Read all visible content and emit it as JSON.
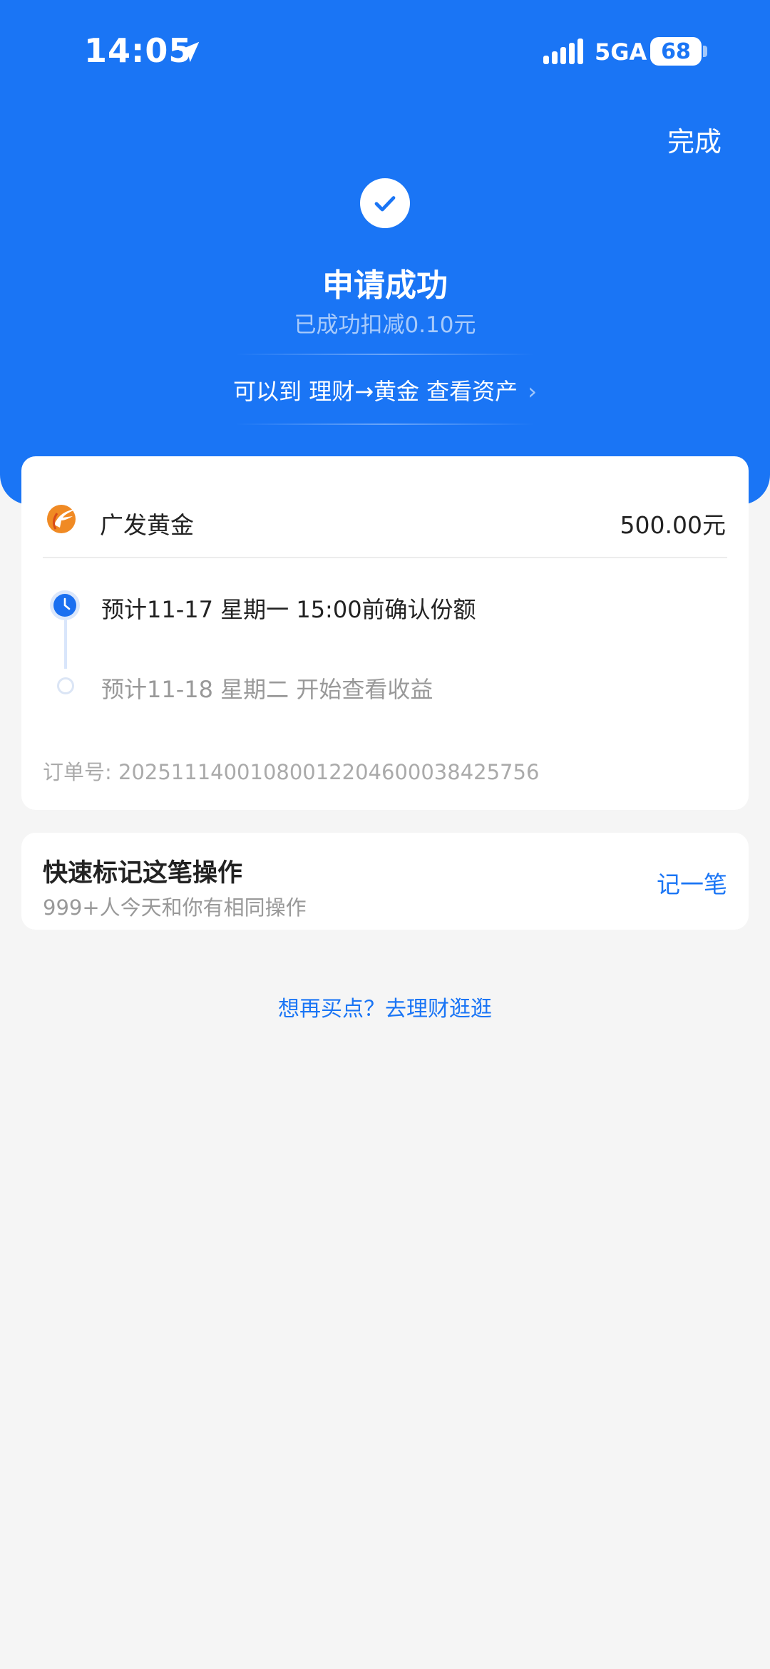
{
  "status_bar": {
    "time": "14:05",
    "network": "5GA",
    "battery": "68"
  },
  "header": {
    "done_label": "完成",
    "title": "申请成功",
    "subtitle": "已成功扣减0.10元",
    "asset_link": "可以到 理财→黄金 查看资产",
    "accent_color": "#1a75f5",
    "icons": [
      "location-arrow-icon",
      "signal-icon",
      "battery-icon",
      "checkmark-icon",
      "chevron-right-icon"
    ]
  },
  "order": {
    "product_name": "广发黄金",
    "amount": "500.00元",
    "steps": [
      {
        "text": "预计11-17 星期一 15:00前确认份额",
        "icon": "clock-icon"
      },
      {
        "text": "预计11-18 星期二 开始查看收益",
        "icon": "hollow-dot-icon"
      }
    ],
    "order_number": "订单号: 2025111400108001220460003842575​6"
  },
  "mark": {
    "title": "快速标记这笔操作",
    "subtitle": "999+人今天和你有相同操作",
    "button": "记一笔"
  },
  "footer": {
    "link": "想再买点？去理财逛逛"
  }
}
